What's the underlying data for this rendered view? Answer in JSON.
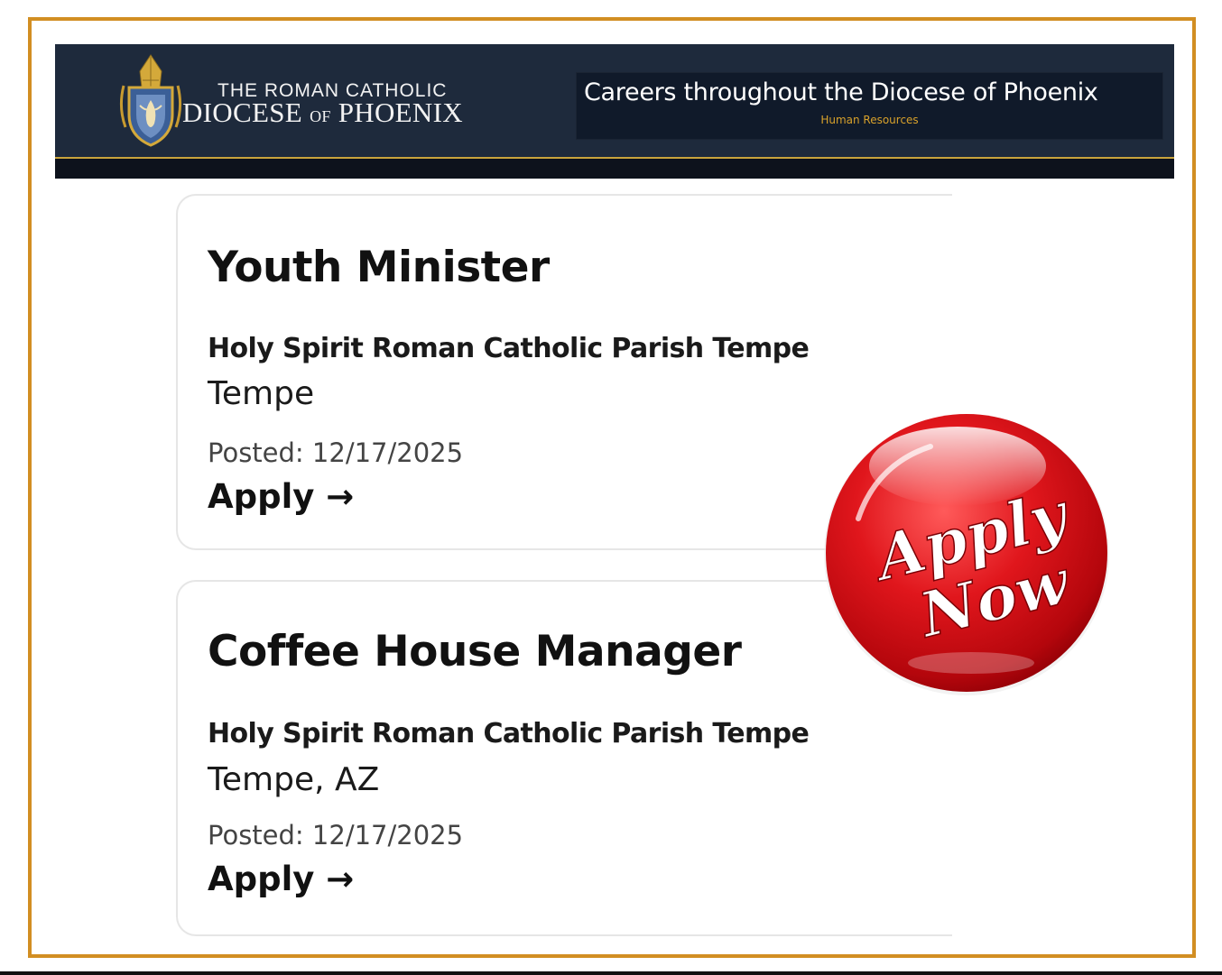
{
  "header": {
    "logo_line1": "THE ROMAN CATHOLIC",
    "logo_line2a": "DIOCESE",
    "logo_line2b": "OF",
    "logo_line2c": "PHOENIX",
    "careers_title": "Careers throughout the Diocese of Phoenix",
    "careers_subtitle": "Human Resources"
  },
  "jobs": [
    {
      "title": "Youth Minister",
      "organization": "Holy Spirit Roman Catholic Parish Tempe",
      "location": "Tempe",
      "posted": "Posted: 12/17/2025",
      "apply_label": "Apply →"
    },
    {
      "title": "Coffee House Manager",
      "organization": "Holy Spirit Roman Catholic Parish Tempe",
      "location": "Tempe, AZ",
      "posted": "Posted: 12/17/2025",
      "apply_label": "Apply →"
    }
  ],
  "apply_now_button": {
    "line1": "Apply",
    "line2": "Now"
  },
  "colors": {
    "frame": "#d28e22",
    "banner": "#1e2a3c",
    "accent_gold": "#d8a12b",
    "button_red": "#d4111a"
  }
}
